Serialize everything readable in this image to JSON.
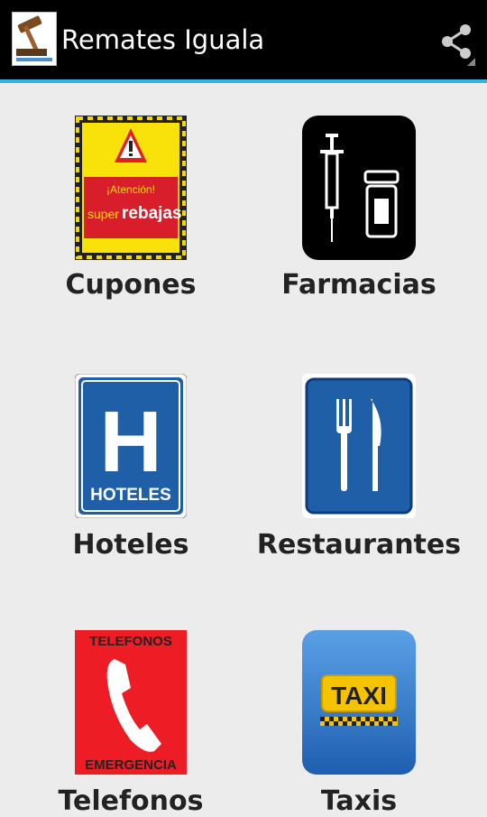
{
  "header": {
    "title": "Remates Iguala",
    "app_icon": "gavel-logo-icon",
    "share_icon": "share-icon"
  },
  "tiles": [
    {
      "label": "Cupones",
      "icon": "coupon-sale-sign-icon",
      "sign_text": [
        "¡Atención!",
        "super",
        "rebajas"
      ]
    },
    {
      "label": "Farmacias",
      "icon": "pharmacy-syringe-icon"
    },
    {
      "label": "Hoteles",
      "icon": "hotel-sign-icon",
      "sign_text": [
        "H",
        "HOTELES"
      ]
    },
    {
      "label": "Restaurantes",
      "icon": "restaurant-fork-knife-icon"
    },
    {
      "label": "Telefonos",
      "icon": "emergency-phone-icon",
      "sign_text": [
        "TELEFONOS",
        "EMERGENCIA"
      ]
    },
    {
      "label": "Taxis",
      "icon": "taxi-sign-icon",
      "sign_text": [
        "TAXI"
      ]
    }
  ],
  "colors": {
    "actionbar": "#000000",
    "accent_line": "#33b5e5",
    "background": "#ececec"
  }
}
